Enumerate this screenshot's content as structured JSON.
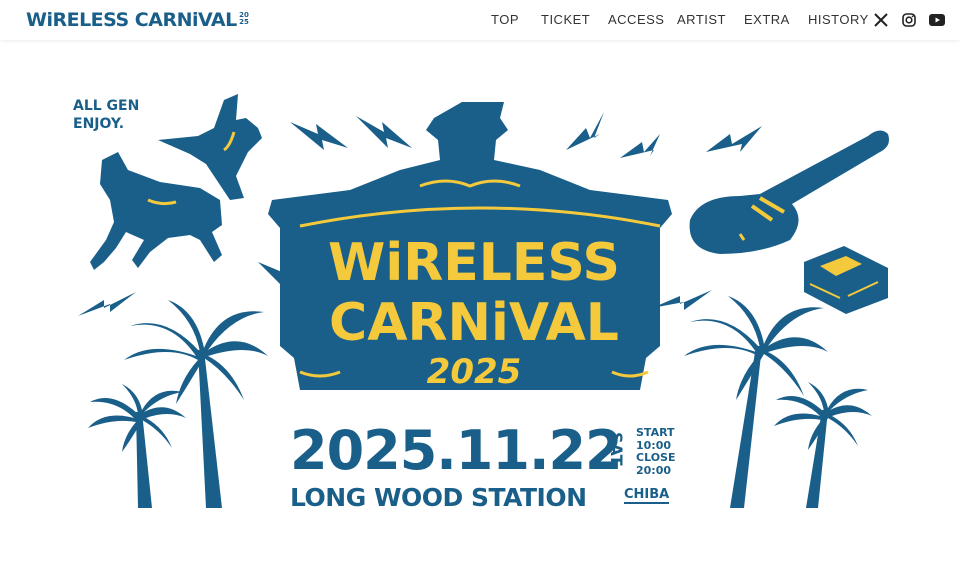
{
  "header": {
    "logo_text": "WiRELESS CARNiVAL",
    "logo_year_top": "20",
    "logo_year_bottom": "25",
    "nav": [
      "TOP",
      "TICKET",
      "ACCESS",
      "ARTIST",
      "EXTRA",
      "HISTORY"
    ],
    "social": [
      "x-icon",
      "instagram-icon",
      "youtube-icon"
    ]
  },
  "hero": {
    "tagline_line1": "ALL GEN",
    "tagline_line2": "ENJOY.",
    "title_line1": "WiRELESS",
    "title_line2": "CARNiVAL",
    "title_year": "2025",
    "date": "2025.11.22",
    "weekday": "SAT",
    "start_label": "START",
    "start_time": "10:00",
    "close_label": "CLOSE",
    "close_time": "20:00",
    "venue": "LONG WOOD STATION",
    "city": "CHIBA"
  },
  "colors": {
    "brand_blue": "#1a5f8a",
    "accent_yellow": "#f4c93b",
    "background": "#ffffff"
  }
}
